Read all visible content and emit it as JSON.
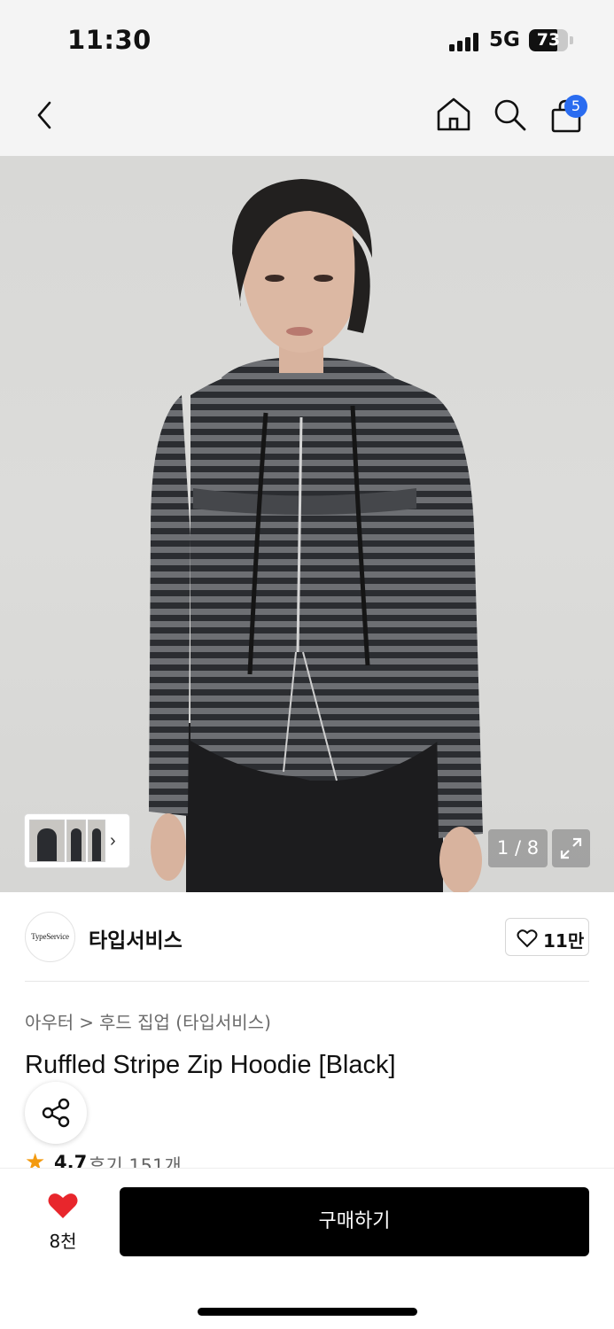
{
  "status_bar": {
    "time": "11:30",
    "network": "5G",
    "battery_level": "73",
    "battery_fraction": 0.73
  },
  "header": {
    "back_icon": "chevron-left-icon",
    "home_icon": "home-icon",
    "search_icon": "search-icon",
    "cart_icon": "shopping-bag-icon",
    "cart_count": "5"
  },
  "gallery": {
    "image_counter": "1 / 8",
    "thumb_arrow": "›",
    "expand_icon": "expand-icon"
  },
  "brand": {
    "logo_text": "TypeService",
    "name": "타입서비스",
    "like_count": "11만"
  },
  "product": {
    "category_parent": "아우터",
    "category_sep": ">",
    "category_child": "후드 집업 (타입서비스)",
    "title": "Ruffled Stripe Zip Hoodie [Black]",
    "rating": "4.7",
    "reviews": "후기 151개"
  },
  "bottom_bar": {
    "wish_count": "8천",
    "buy_label": "구매하기"
  },
  "colors": {
    "accent_badge": "#2a6cf0",
    "heart_red": "#e8262c",
    "star_orange": "#f39a0f",
    "buy_button": "#000000"
  }
}
